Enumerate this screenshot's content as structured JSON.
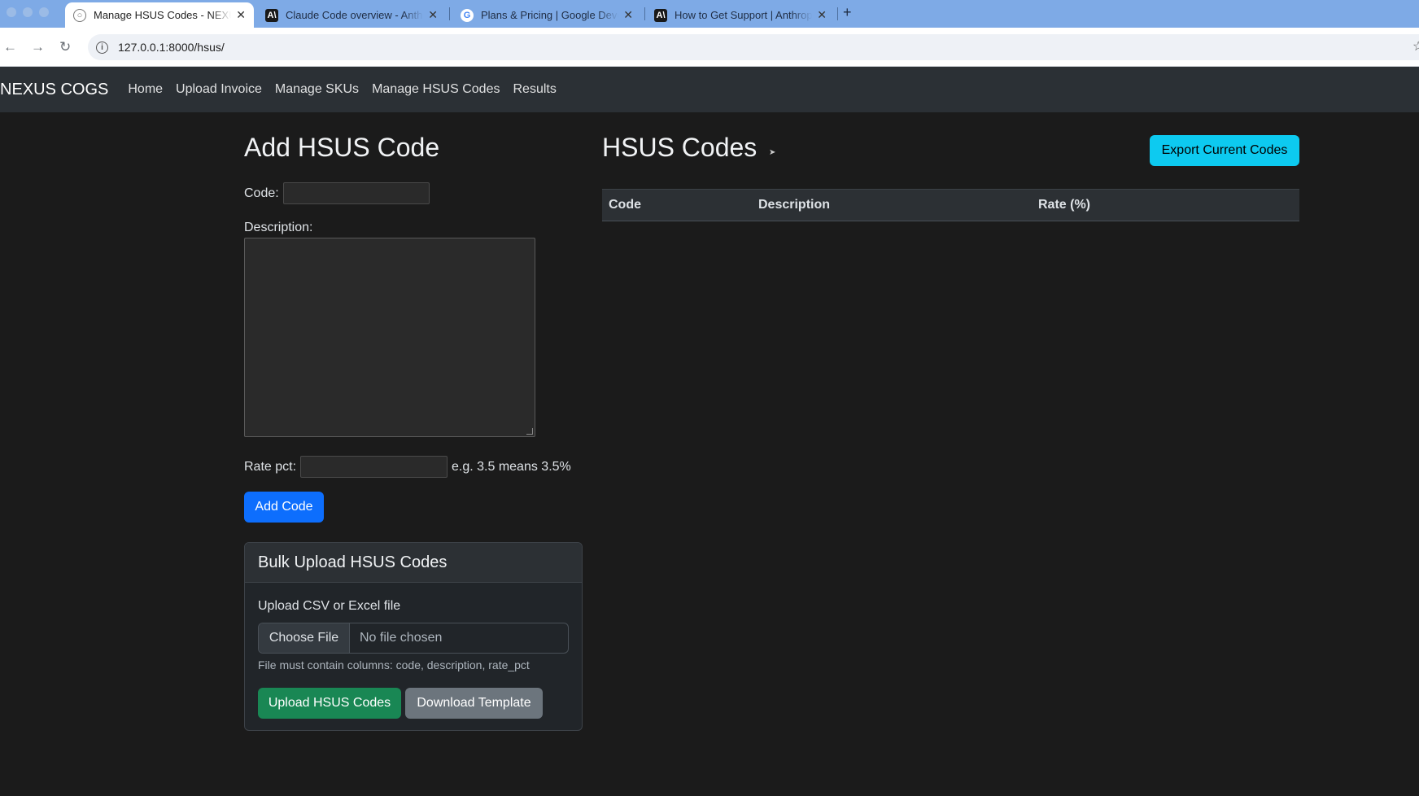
{
  "browser": {
    "tabs": [
      {
        "title": "Manage HSUS Codes - NEXUS COGS",
        "icon": "globe-icon",
        "active": true
      },
      {
        "title": "Claude Code overview - Anthropic",
        "icon": "anthropic-icon",
        "active": false
      },
      {
        "title": "Plans & Pricing | Google Developers",
        "icon": "google-icon",
        "active": false
      },
      {
        "title": "How to Get Support | Anthropic",
        "icon": "anthropic-icon",
        "active": false
      }
    ],
    "address": "127.0.0.1:8000/hsus/"
  },
  "navbar": {
    "brand": "NEXUS COGS",
    "links": [
      "Home",
      "Upload Invoice",
      "Manage SKUs",
      "Manage HSUS Codes",
      "Results"
    ]
  },
  "add_form": {
    "heading": "Add HSUS Code",
    "code_label": "Code:",
    "code_value": "",
    "description_label": "Description:",
    "description_value": "",
    "rate_label": "Rate pct:",
    "rate_value": "",
    "rate_hint": "e.g. 3.5 means 3.5%",
    "submit_label": "Add Code"
  },
  "bulk_upload": {
    "heading": "Bulk Upload HSUS Codes",
    "file_label": "Upload CSV or Excel file",
    "choose_file": "Choose File",
    "no_file": "No file chosen",
    "help": "File must contain columns: code, description, rate_pct",
    "upload_label": "Upload HSUS Codes",
    "template_label": "Download Template"
  },
  "codes_table": {
    "heading": "HSUS Codes",
    "export_label": "Export Current Codes",
    "columns": [
      "Code",
      "Description",
      "Rate (%)"
    ],
    "rows": []
  },
  "colors": {
    "background": "#1b1b1b",
    "navbar": "#2b3035",
    "primary": "#0d6efd",
    "success": "#198754",
    "secondary": "#6c757d",
    "info": "#0dcaf0"
  }
}
